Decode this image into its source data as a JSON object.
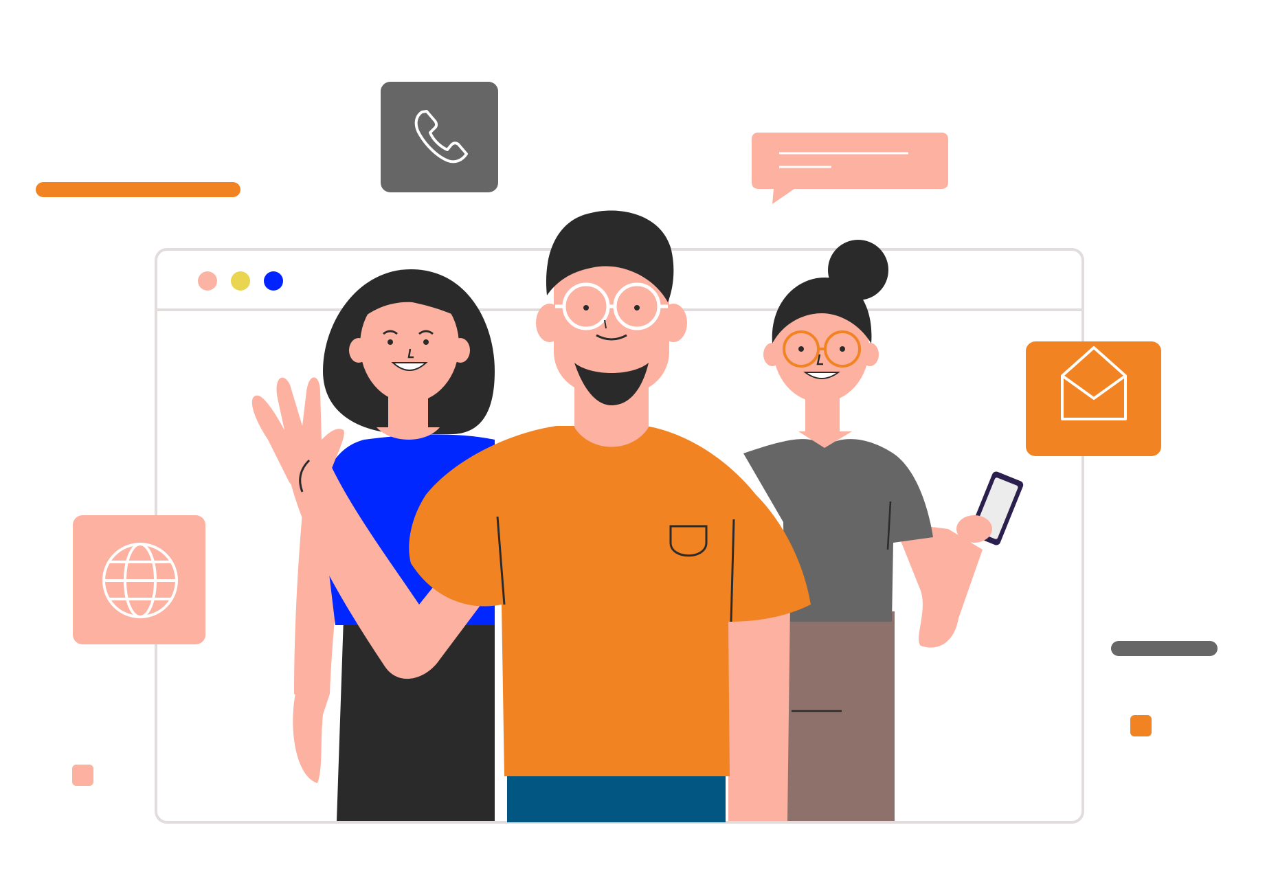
{
  "illustration": {
    "window_controls": [
      {
        "name": "red-dot",
        "color": "#fbb3a4"
      },
      {
        "name": "yellow-dot",
        "color": "#e9d54f"
      },
      {
        "name": "blue-dot",
        "color": "#0023ff"
      }
    ],
    "icons": [
      "phone-icon",
      "chat-bubble-icon",
      "mail-icon",
      "globe-icon",
      "smartphone-icon"
    ],
    "people": [
      "woman-blue-top",
      "man-orange-shirt",
      "woman-grey-top"
    ],
    "colors": {
      "orange": "#f28322",
      "peach": "#fcb1a1",
      "grey": "#666666",
      "blue": "#0027ff",
      "dark": "#2a2a2a",
      "navy": "#015682",
      "brown": "#8e716a",
      "frame": "#e2dcdc"
    }
  }
}
